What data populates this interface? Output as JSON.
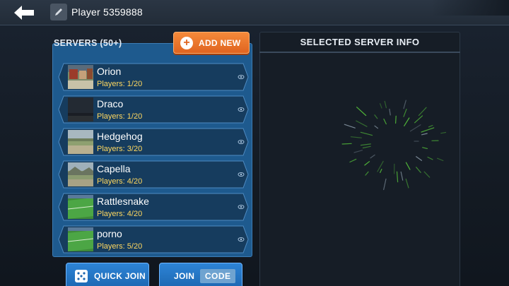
{
  "header": {
    "player_name": "Player 5359888"
  },
  "servers": {
    "label": "SERVERS (50+)",
    "add_new_label": "ADD NEW",
    "items": [
      {
        "name": "Orion",
        "players": "Players: 1/20",
        "thumb": "village"
      },
      {
        "name": "Draco",
        "players": "Players: 1/20",
        "thumb": "night"
      },
      {
        "name": "Hedgehog",
        "players": "Players: 3/20",
        "thumb": "field"
      },
      {
        "name": "Capella",
        "players": "Players: 4/20",
        "thumb": "mountain"
      },
      {
        "name": "Rattlesnake",
        "players": "Players: 4/20",
        "thumb": "stadium"
      },
      {
        "name": "porno",
        "players": "Players: 5/20",
        "thumb": "stadium"
      }
    ]
  },
  "bottom_buttons": {
    "quick_join_label": "QUICK JOIN",
    "join_label": "JOIN",
    "code_label": "CODE"
  },
  "info_panel": {
    "title": "SELECTED SERVER INFO"
  },
  "colors": {
    "panel_blue": "#1e5a8e",
    "row_blue": "#163c5e",
    "accent_orange": "#e06420",
    "players_yellow": "#ffd860",
    "loading_green": "#55c23a"
  },
  "icons": {
    "back": "back-arrow-icon",
    "edit": "pencil-icon",
    "add": "plus-circle-icon",
    "row": "eye-icon",
    "quick_join": "dice-icon"
  }
}
